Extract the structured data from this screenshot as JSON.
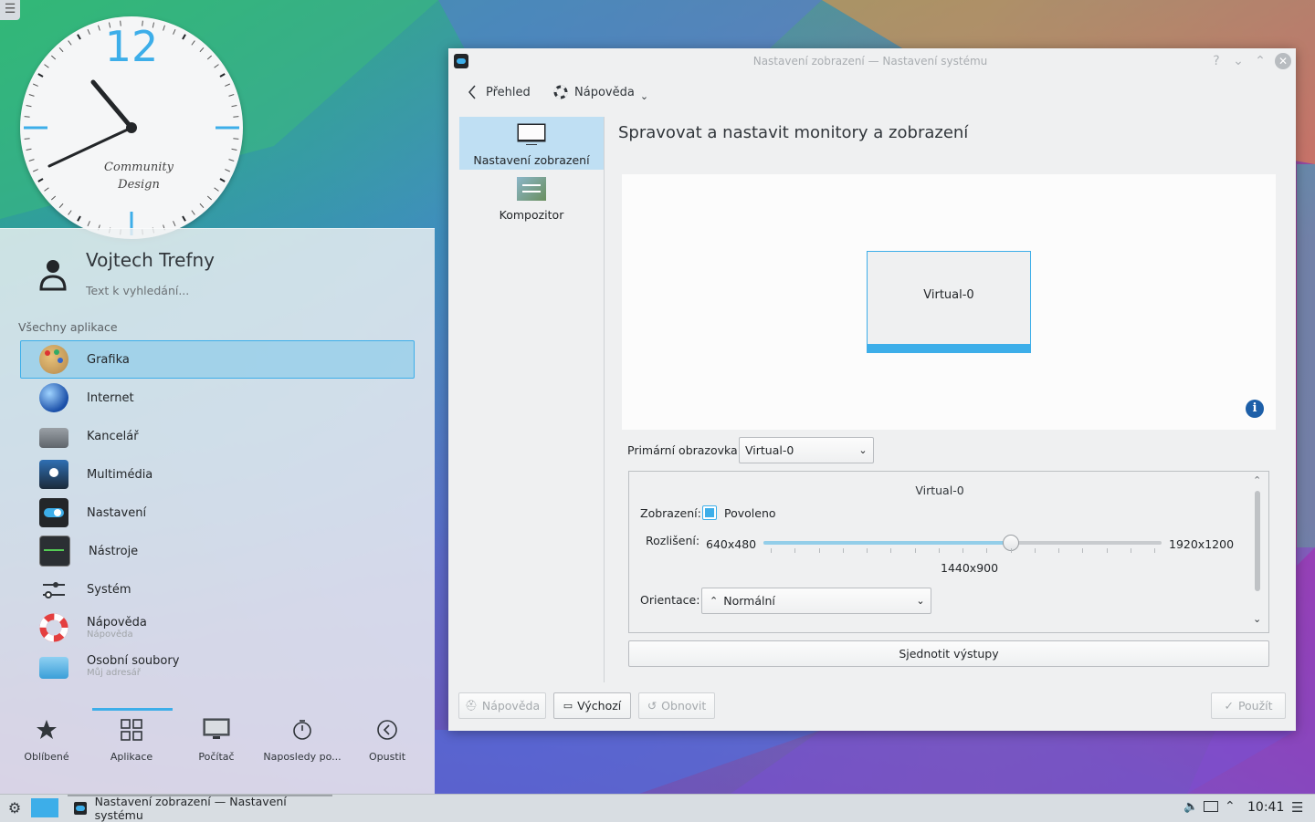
{
  "clock": {
    "number": "12",
    "brand_line1": "Community",
    "brand_line2": "Design"
  },
  "launcher": {
    "user_name": "Vojtech Trefny",
    "search_placeholder": "Text k vyhledání...",
    "section_title": "Všechny aplikace",
    "apps": [
      {
        "label": "Grafika",
        "sub": "",
        "icon": "palette-icon"
      },
      {
        "label": "Internet",
        "sub": "",
        "icon": "globe-icon"
      },
      {
        "label": "Kancelář",
        "sub": "",
        "icon": "typewriter-icon"
      },
      {
        "label": "Multimédia",
        "sub": "",
        "icon": "media-icon"
      },
      {
        "label": "Nastavení",
        "sub": "",
        "icon": "settings-toggle-icon"
      },
      {
        "label": "Nástroje",
        "sub": "",
        "icon": "terminal-icon"
      },
      {
        "label": "Systém",
        "sub": "",
        "icon": "system-sliders-icon"
      },
      {
        "label": "Nápověda",
        "sub": "Nápověda",
        "icon": "lifebuoy-icon"
      },
      {
        "label": "Osobní soubory",
        "sub": "Můj adresář",
        "icon": "home-folder-icon"
      }
    ],
    "tabs": [
      {
        "label": "Oblíbené",
        "icon": "star-icon"
      },
      {
        "label": "Aplikace",
        "icon": "grid-icon"
      },
      {
        "label": "Počítač",
        "icon": "computer-icon"
      },
      {
        "label": "Naposledy po...",
        "icon": "history-icon"
      },
      {
        "label": "Opustit",
        "icon": "leave-icon"
      }
    ]
  },
  "window": {
    "title": "Nastavení zobrazení — Nastavení systému",
    "toolbar": {
      "back_label": "Přehled",
      "help_label": "Nápověda"
    },
    "sidebar": [
      {
        "label": "Nastavení zobrazení",
        "icon": "monitor-icon"
      },
      {
        "label": "Kompozitor",
        "icon": "compositor-icon"
      }
    ],
    "content_title": "Spravovat a nastavit monitory a zobrazení",
    "monitor_label": "Virtual-0",
    "primary_label": "Primární obrazovka:",
    "primary_value": "Virtual-0",
    "output": {
      "name": "Virtual-0",
      "display_label": "Zobrazení:",
      "enabled_label": "Povoleno",
      "enabled": true,
      "resolution_label": "Rozlišení:",
      "res_min": "640x480",
      "res_max": "1920x1200",
      "res_current": "1440x900",
      "slider_fraction": 0.62,
      "orientation_label": "Orientace:",
      "orientation_value": "Normální"
    },
    "unify_label": "Sjednotit výstupy",
    "buttons": {
      "help": "Nápověda",
      "defaults": "Výchozí",
      "reset": "Obnovit",
      "apply": "Použít"
    }
  },
  "taskbar": {
    "task_title": "Nastavení zobrazení — Nastavení systému",
    "time": "10:41"
  },
  "colors": {
    "accent": "#3daee9",
    "selection": "#bfdff3"
  }
}
